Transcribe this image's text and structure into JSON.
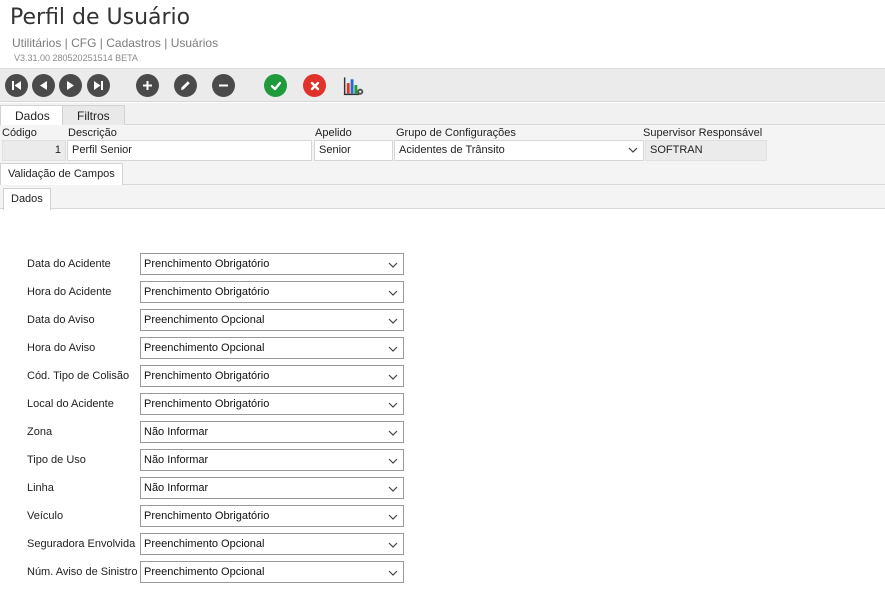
{
  "header": {
    "title": "Perfil de Usuário",
    "breadcrumb": "Utilitários | CFG | Cadastros | Usuários",
    "version": "V3.31.00 280520251514 BETA"
  },
  "toolbar": {
    "buttons": [
      "first-record-icon",
      "previous-record-icon",
      "next-record-icon",
      "last-record-icon",
      "add-icon",
      "edit-icon",
      "remove-icon",
      "confirm-icon",
      "cancel-icon",
      "report-chart-icon"
    ]
  },
  "tabs": [
    "Dados",
    "Filtros"
  ],
  "form": {
    "codigo_label": "Código",
    "codigo_value": "1",
    "descricao_label": "Descrição",
    "descricao_value": "Perfil Senior",
    "apelido_label": "Apelido",
    "apelido_value": "Senior",
    "grupo_label": "Grupo de Configurações",
    "grupo_value": "Acidentes de Trânsito",
    "supervisor_label": "Supervisor Responsável",
    "supervisor_value": "SOFTRAN"
  },
  "subtab": "Validação de Campos",
  "innertab": "Dados",
  "validation_rows": [
    {
      "label": "Data do Acidente",
      "value": "Prenchimento Obrigatório"
    },
    {
      "label": "Hora do Acidente",
      "value": "Prenchimento Obrigatório"
    },
    {
      "label": "Data do Aviso",
      "value": "Preenchimento Opcional"
    },
    {
      "label": "Hora do Aviso",
      "value": "Preenchimento Opcional"
    },
    {
      "label": "Cód. Tipo de Colisão",
      "value": "Prenchimento Obrigatório"
    },
    {
      "label": "Local do Acidente",
      "value": "Prenchimento Obrigatório"
    },
    {
      "label": "Zona",
      "value": "Não Informar"
    },
    {
      "label": "Tipo de Uso",
      "value": "Não Informar"
    },
    {
      "label": "Linha",
      "value": "Não Informar"
    },
    {
      "label": "Veículo",
      "value": "Prenchimento Obrigatório"
    },
    {
      "label": "Seguradora Envolvida",
      "value": "Preenchimento Opcional"
    },
    {
      "label": "Núm. Aviso de Sinistro",
      "value": "Preenchimento Opcional"
    }
  ],
  "colors": {
    "toolbar_bg": "#ebebeb",
    "nav_icon": "#4a4a4a",
    "confirm": "#1f9a3c",
    "cancel": "#e0312b"
  }
}
